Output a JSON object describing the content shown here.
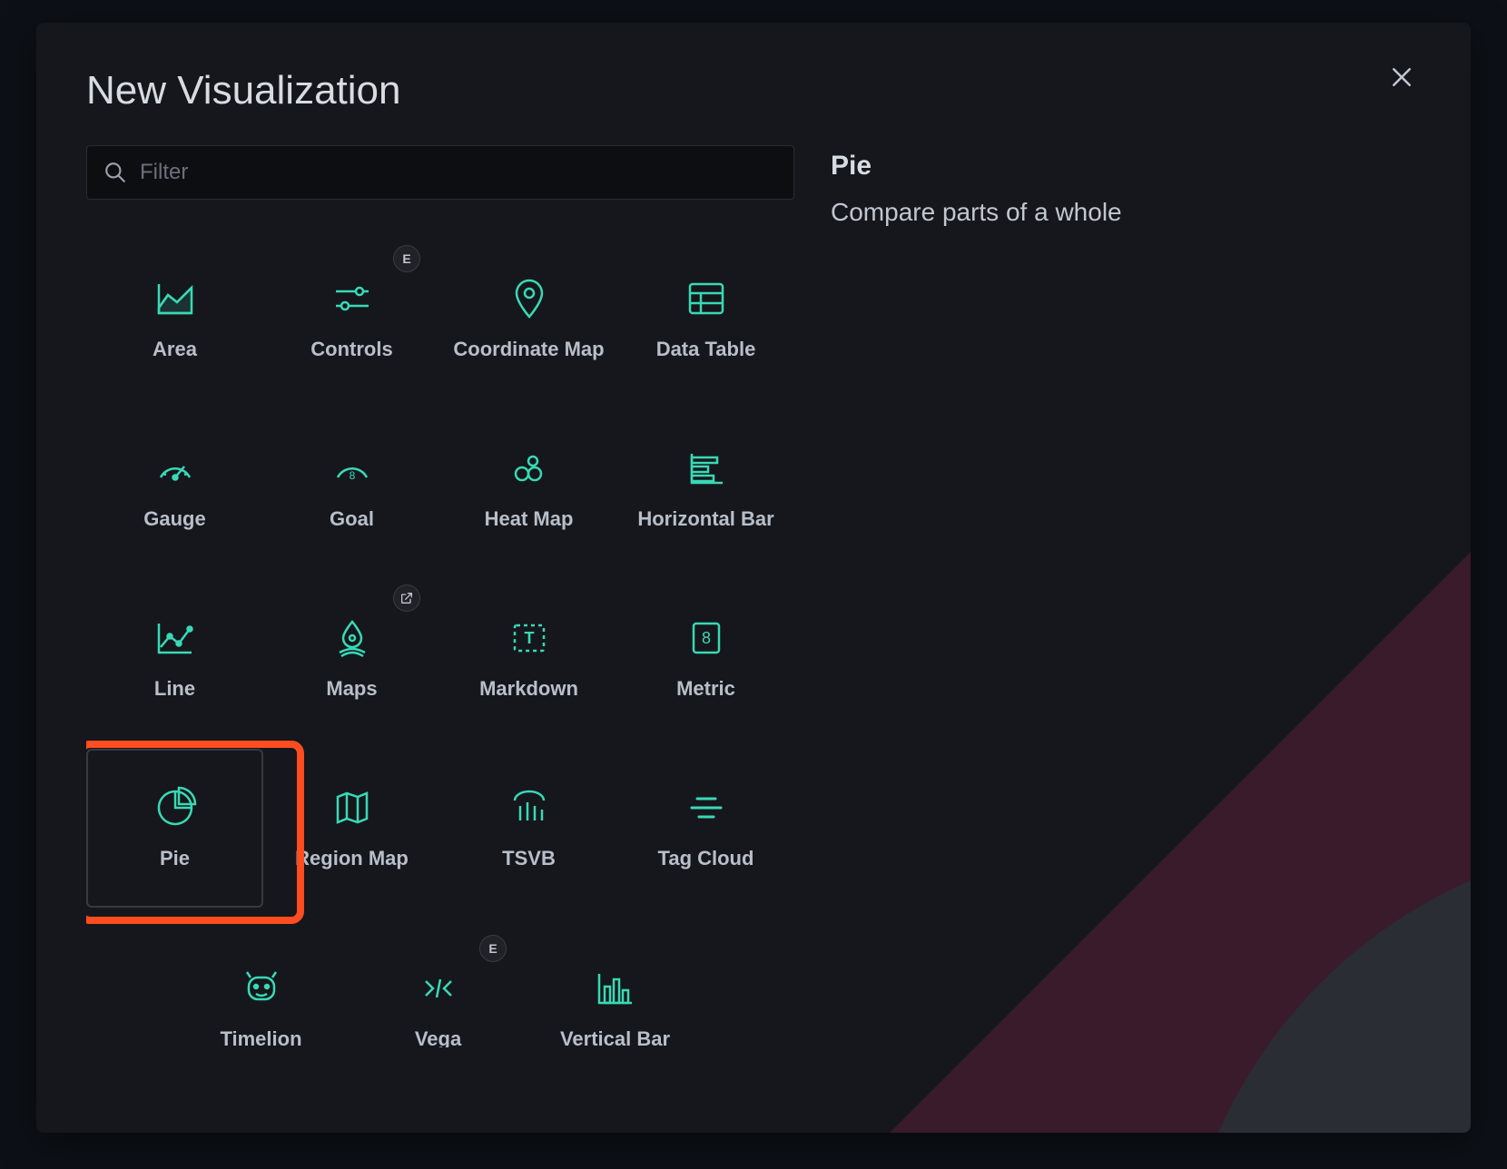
{
  "modal": {
    "title": "New Visualization",
    "filter_placeholder": "Filter"
  },
  "selected": {
    "title": "Pie",
    "description": "Compare parts of a whole"
  },
  "badge_e": "E",
  "viz": [
    {
      "label": "Area"
    },
    {
      "label": "Controls"
    },
    {
      "label": "Coordinate Map"
    },
    {
      "label": "Data Table"
    },
    {
      "label": "Gauge"
    },
    {
      "label": "Goal"
    },
    {
      "label": "Heat Map"
    },
    {
      "label": "Horizontal Bar"
    },
    {
      "label": "Line"
    },
    {
      "label": "Maps"
    },
    {
      "label": "Markdown"
    },
    {
      "label": "Metric"
    },
    {
      "label": "Pie"
    },
    {
      "label": "Region Map"
    },
    {
      "label": "TSVB"
    },
    {
      "label": "Tag Cloud"
    },
    {
      "label": "Timelion"
    },
    {
      "label": "Vega"
    },
    {
      "label": "Vertical Bar"
    }
  ]
}
